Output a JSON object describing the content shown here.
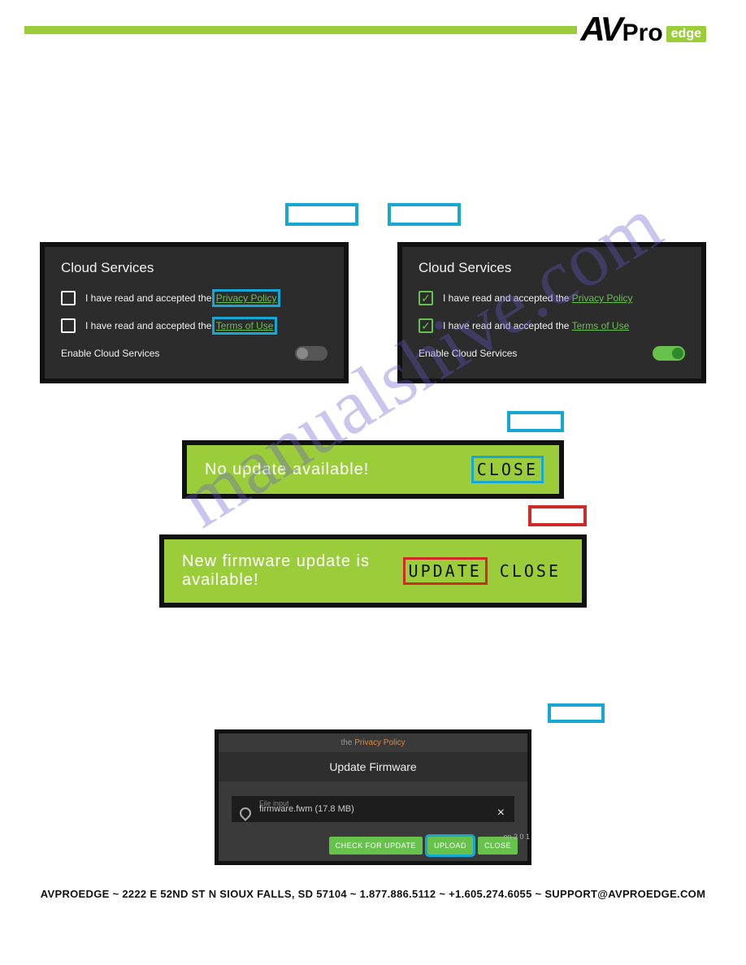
{
  "brand": {
    "av": "AV",
    "pro": "Pro",
    "edge": "edge"
  },
  "cloud": {
    "title": "Cloud Services",
    "line_pref": "I have read and accepted the",
    "privacy": "Privacy Policy",
    "terms": "Terms of Use",
    "enable_label": "Enable Cloud Services"
  },
  "banner1": {
    "msg": "No update available!",
    "close": "CLOSE"
  },
  "banner2": {
    "msg": "New firmware update is available!",
    "update": "UPDATE",
    "close": "CLOSE"
  },
  "fw": {
    "hint_pre": "the ",
    "hint_link": "Privacy Policy",
    "title": "Update Firmware",
    "file_label": "File input",
    "file_name": "firmware.fwm (17.8 MB)",
    "btn_check": "CHECK FOR UPDATE",
    "btn_upload": "UPLOAD",
    "btn_close": "CLOSE",
    "side": "on\n2\n0\n1"
  },
  "watermark": "manualshive.com",
  "footer": "AVPROEDGE ~ 2222 E 52ND ST N SIOUX FALLS, SD 57104 ~ 1.877.886.5112 ~ +1.605.274.6055 ~ SUPPORT@AVPROEDGE.COM"
}
